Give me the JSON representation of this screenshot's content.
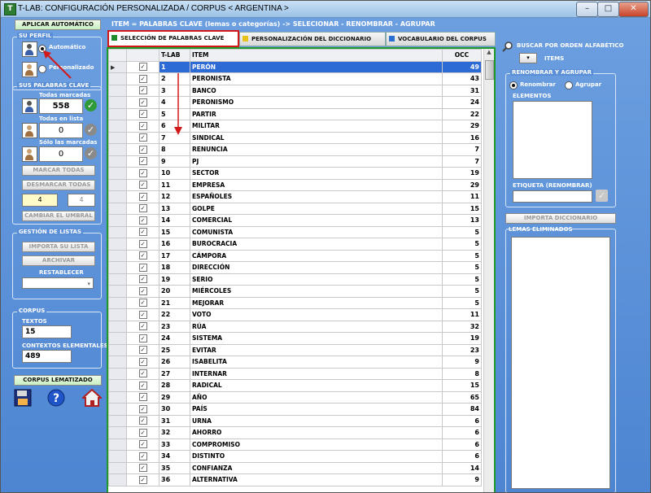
{
  "window": {
    "title": "T-LAB: CONFIGURACIÓN PERSONALIZADA  /  CORPUS < ARGENTINA >",
    "app_icon": "T"
  },
  "window_buttons": {
    "minimize": "–",
    "maximize": "□",
    "close": "✕"
  },
  "left": {
    "aplicar_btn": "APLICAR AUTOMÁTICO",
    "su_perfil": {
      "label": "SU PERFIL",
      "automatico": "Automático",
      "personalizado": "Personalizado"
    },
    "sus_palabras": {
      "label": "SUS PALABRAS CLAVE",
      "todas_marcadas_label": "Todas marcadas",
      "todas_marcadas_value": "558",
      "todas_lista_label": "Todas en lista",
      "todas_lista_value": "0",
      "solo_marcadas_label": "Sólo las marcadas",
      "solo_marcadas_value": "0",
      "marcar_todas": "MARCAR TODAS",
      "desmarcar_todas": "DESMARCAR TODAS",
      "threshold_value": "4",
      "threshold_spin": "4",
      "cambiar_umbral": "CAMBIAR EL UMBRAL"
    },
    "gestion": {
      "label": "GESTIÓN DE LISTAS",
      "importa": "IMPORTA SU LISTA",
      "archivar": "ARCHIVAR",
      "restablecer": "RESTABLECER"
    },
    "corpus": {
      "label": "CORPUS",
      "textos_label": "TEXTOS",
      "textos_value": "15",
      "contextos_label": "CONTEXTOS ELEMENTALES",
      "contextos_value": "489"
    },
    "lematizado_btn": "CORPUS LEMATIZADO"
  },
  "header": {
    "text": "ITEM = PALABRAS CLAVE (lemas o categorías)  -> SELECIONAR - RENOMBRAR - AGRUPAR"
  },
  "tabs": [
    {
      "label": "SELECCIÓN DE PALABRAS CLAVE",
      "color": "#1f8a2a"
    },
    {
      "label": "PERSONALIZACIÓN DEL DICCIONARIO",
      "color": "#e6c21a"
    },
    {
      "label": "VOCABULARIO DEL CORPUS",
      "color": "#2a6fd1"
    }
  ],
  "grid": {
    "columns": [
      "",
      "",
      "T-LAB",
      "ITEM",
      "OCC"
    ],
    "rows": [
      [
        "1",
        "PERÓN",
        "49"
      ],
      [
        "2",
        "PERONISTA",
        "43"
      ],
      [
        "3",
        "BANCO",
        "31"
      ],
      [
        "4",
        "PERONISMO",
        "24"
      ],
      [
        "5",
        "PARTIR",
        "22"
      ],
      [
        "6",
        "MILITAR",
        "29"
      ],
      [
        "7",
        "SINDICAL",
        "16"
      ],
      [
        "8",
        "RENUNCIA",
        "7"
      ],
      [
        "9",
        "PJ",
        "7"
      ],
      [
        "10",
        "SECTOR",
        "19"
      ],
      [
        "11",
        "EMPRESA",
        "29"
      ],
      [
        "12",
        "ESPAÑOLES",
        "11"
      ],
      [
        "13",
        "GOLPE",
        "15"
      ],
      [
        "14",
        "COMERCIAL",
        "13"
      ],
      [
        "15",
        "COMUNISTA",
        "5"
      ],
      [
        "16",
        "BUROCRACIA",
        "5"
      ],
      [
        "17",
        "CÁMPORA",
        "5"
      ],
      [
        "18",
        "DIRECCIÓN",
        "5"
      ],
      [
        "19",
        "SERIO",
        "5"
      ],
      [
        "20",
        "MIÉRCOLES",
        "5"
      ],
      [
        "21",
        "MEJORAR",
        "5"
      ],
      [
        "22",
        "VOTO",
        "11"
      ],
      [
        "23",
        "RÚA",
        "32"
      ],
      [
        "24",
        "SISTEMA",
        "19"
      ],
      [
        "25",
        "EVITAR",
        "23"
      ],
      [
        "26",
        "ISABELITA",
        "9"
      ],
      [
        "27",
        "INTERNAR",
        "8"
      ],
      [
        "28",
        "RADICAL",
        "15"
      ],
      [
        "29",
        "AÑO",
        "65"
      ],
      [
        "30",
        "PAÍS",
        "84"
      ],
      [
        "31",
        "URNA",
        "6"
      ],
      [
        "32",
        "AHORRO",
        "6"
      ],
      [
        "33",
        "COMPROMISO",
        "6"
      ],
      [
        "34",
        "DISTINTO",
        "6"
      ],
      [
        "35",
        "CONFIANZA",
        "14"
      ],
      [
        "36",
        "ALTERNATIVA",
        "9"
      ]
    ]
  },
  "right": {
    "buscar": "BUSCAR POR ORDEN ALFABÉTICO",
    "items_label": "ITEMS",
    "renombrar_group": "RENOMBRAR Y AGRUPAR",
    "renombrar": "Renombrar",
    "agrupar": "Agrupar",
    "elementos": "ELEMENTOS",
    "etiqueta": "ETIQUETA (RENOMBRAR)",
    "importa_diccionario": "IMPORTA DICCIONARIO",
    "lemas_eliminados": "LEMAS ELIMINADOS"
  },
  "colors": {
    "background": "#5b8fd6",
    "grid_border": "#1f9a2a",
    "highlight_border": "#d21818",
    "selected_row": "#2c6ad6"
  },
  "icons": [
    "save-icon",
    "help-icon",
    "home-icon",
    "search-icon",
    "person-icon",
    "check-icon"
  ]
}
